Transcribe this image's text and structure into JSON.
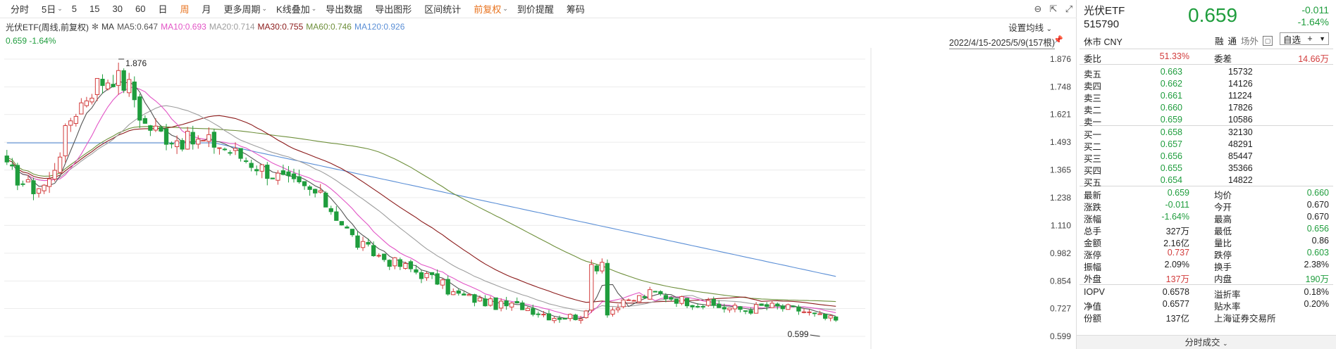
{
  "toolbar": {
    "items": [
      "分时",
      "5日",
      "5",
      "15",
      "30",
      "60",
      "日",
      "周",
      "月",
      "更多周期",
      "K线叠加",
      "导出数据",
      "导出图形",
      "区间统计",
      "前复权",
      "到价提醒",
      "筹码"
    ],
    "active": "周",
    "dropdown_marks": [
      "5日",
      "更多周期",
      "K线叠加",
      "前复权"
    ]
  },
  "ma_info": {
    "title": "光伏ETF(周线,前复权)",
    "ma_label": "MA",
    "ma5": "MA5:0.647",
    "ma10": "MA10:0.693",
    "ma20": "MA20:0.714",
    "ma30": "MA30:0.755",
    "ma60": "MA60:0.746",
    "ma120": "MA120:0.926"
  },
  "price_line": "0.659  -1.64%",
  "settings_label": "设置均线",
  "date_range": "2022/4/15-2025/5/9(157根)",
  "y_axis": [
    "1.876",
    "1.748",
    "1.621",
    "1.493",
    "1.365",
    "1.238",
    "1.110",
    "0.982",
    "0.854",
    "0.727",
    "0.599"
  ],
  "annotations": {
    "high": "1.876",
    "low": "0.599"
  },
  "colors": {
    "up": "#d23c3c",
    "down": "#1f9d3d",
    "ma5": "#555555",
    "ma10": "#e255c6",
    "ma20": "#9e9e9e",
    "ma30": "#8b1a1a",
    "ma60": "#6e8f3b",
    "ma120": "#5b8fd6"
  },
  "quote": {
    "name": "光伏ETF",
    "code": "515790",
    "price": "0.659",
    "change": "-0.011",
    "change_pct": "-1.64%",
    "status": "休市 CNY",
    "tag1": "融",
    "tag2": "通",
    "tag3": "场外",
    "fav_label": "自选",
    "fav_plus": "+",
    "weibi_label": "委比",
    "weibi_value": "51.33%",
    "weicha_label": "委差",
    "weicha_value": "14.66万",
    "asks": [
      {
        "label": "卖五",
        "price": "0.663",
        "vol": "15732"
      },
      {
        "label": "卖四",
        "price": "0.662",
        "vol": "14126"
      },
      {
        "label": "卖三",
        "price": "0.661",
        "vol": "11224"
      },
      {
        "label": "卖二",
        "price": "0.660",
        "vol": "17826"
      },
      {
        "label": "卖一",
        "price": "0.659",
        "vol": "10586"
      }
    ],
    "bids": [
      {
        "label": "买一",
        "price": "0.658",
        "vol": "32130"
      },
      {
        "label": "买二",
        "price": "0.657",
        "vol": "48291"
      },
      {
        "label": "买三",
        "price": "0.656",
        "vol": "85447"
      },
      {
        "label": "买四",
        "price": "0.655",
        "vol": "35366"
      },
      {
        "label": "买五",
        "price": "0.654",
        "vol": "14822"
      }
    ],
    "stats": [
      {
        "l1": "最新",
        "v1": "0.659",
        "c1": "green",
        "l2": "均价",
        "v2": "0.660",
        "c2": "green"
      },
      {
        "l1": "涨跌",
        "v1": "-0.011",
        "c1": "green",
        "l2": "今开",
        "v2": "0.670",
        "c2": ""
      },
      {
        "l1": "涨幅",
        "v1": "-1.64%",
        "c1": "green",
        "l2": "最高",
        "v2": "0.670",
        "c2": ""
      },
      {
        "l1": "总手",
        "v1": "327万",
        "c1": "",
        "l2": "最低",
        "v2": "0.656",
        "c2": "green"
      },
      {
        "l1": "金额",
        "v1": "2.16亿",
        "c1": "",
        "l2": "量比",
        "v2": "0.86",
        "c2": ""
      },
      {
        "l1": "涨停",
        "v1": "0.737",
        "c1": "red",
        "l2": "跌停",
        "v2": "0.603",
        "c2": "green"
      },
      {
        "l1": "振幅",
        "v1": "2.09%",
        "c1": "",
        "l2": "换手",
        "v2": "2.38%",
        "c2": ""
      },
      {
        "l1": "外盘",
        "v1": "137万",
        "c1": "red",
        "l2": "内盘",
        "v2": "190万",
        "c2": "green"
      }
    ],
    "extra": [
      {
        "l1": "IOPV",
        "v1": "0.6578",
        "l2": "溢折率",
        "v2": "0.18%"
      },
      {
        "l1": "净值",
        "v1": "0.6577",
        "l2": "贴水率",
        "v2": "0.20%"
      },
      {
        "l1": "份额",
        "v1": "137亿",
        "l2": "上海证券交易所",
        "v2": ""
      }
    ],
    "bottom": "分时成交"
  }
}
